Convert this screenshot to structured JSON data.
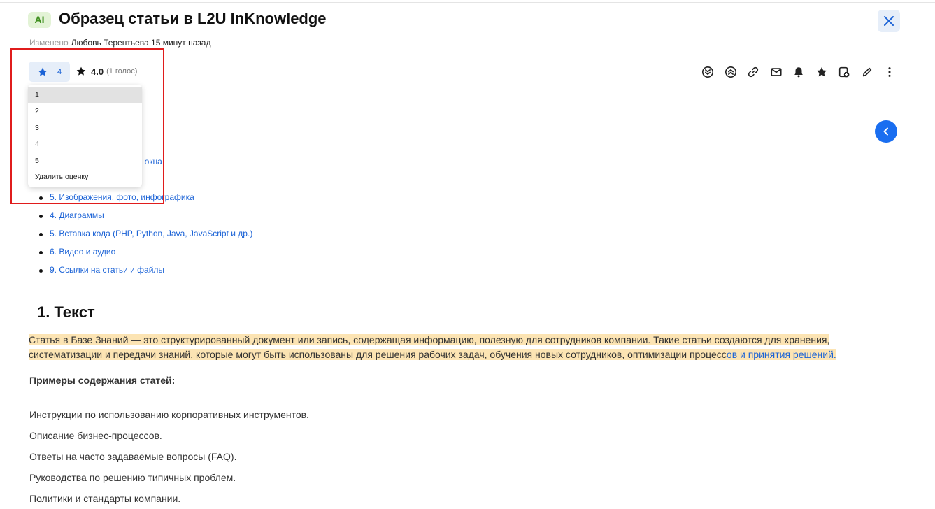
{
  "article": {
    "badge": "AI",
    "title": "Образец статьи в L2U InKnowledge",
    "modified_label": "Изменено",
    "modified_by": "Любовь Терентьева 15 минут назад"
  },
  "rating": {
    "my_rating": "4",
    "average": "4.0",
    "votes_text": "(1 голос)",
    "dropdown_options": [
      "1",
      "2",
      "3",
      "4",
      "5",
      "Удалить оценку"
    ],
    "hovered_option": "1",
    "current_option": "4"
  },
  "toolbar": {
    "icons": [
      "chevrons-down-circle-icon",
      "chevrons-up-circle-icon",
      "link-icon",
      "mail-icon",
      "bell-icon",
      "star-icon",
      "bookmark-icon",
      "edit-icon",
      "more-icon"
    ]
  },
  "toc": {
    "partial_item": "щие окна",
    "items": [
      "5. Изображения, фото, инфографика",
      "4. Диаграммы",
      "5. Вставка кода (PHP, Python, Java, JavaScript и др.)",
      "6. Видео и аудио",
      "9. Ссылки на статьи и файлы"
    ]
  },
  "content": {
    "heading": "1. Текст",
    "paragraph_highlighted": "Статья в Базе Знаний — это структурированный документ или запись, содержащая информацию, полезную для сотрудников компании. Такие статьи создаются для хранения, систематизации и передачи знаний, которые могут быть использованы для решения рабочих задач, обучения новых сотрудников, оптимизации процесс",
    "paragraph_link": "ов и принятия решений.",
    "examples_title": "Примеры содержания статей:",
    "examples": [
      "Инструкции по использованию корпоративных инструментов.",
      "Описание бизнес-процессов.",
      "Ответы на часто задаваемые вопросы (FAQ).",
      "Руководства по решению типичных проблем.",
      "Политики и стандарты компании."
    ]
  },
  "colors": {
    "accent": "#1a6ef0",
    "highlight": "#fce4b3",
    "annotation": "#e01c1c"
  }
}
